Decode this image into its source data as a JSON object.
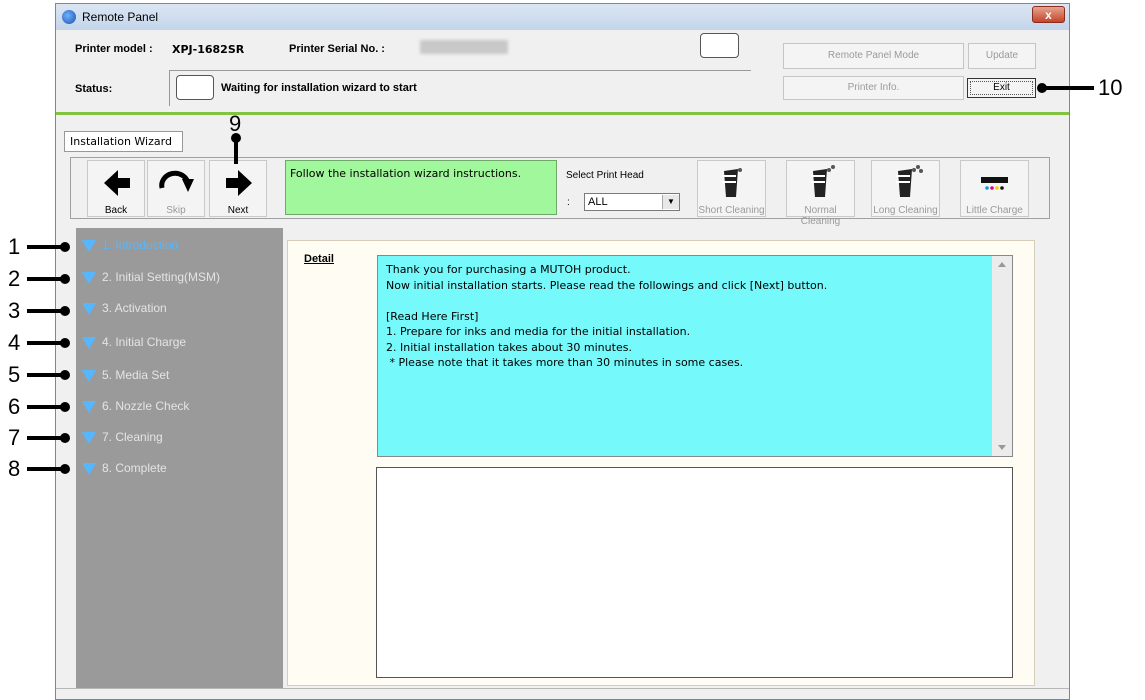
{
  "window": {
    "title": "Remote Panel",
    "close_label": "x"
  },
  "header": {
    "printer_model_label": "Printer model :",
    "printer_model_value": "XPJ-1682SR",
    "serial_label": "Printer Serial No. :",
    "serial_value": "",
    "status_label": "Status:",
    "status_text": "Waiting for installation wizard to start",
    "buttons": {
      "remote_panel_mode": "Remote Panel Mode",
      "update": "Update",
      "printer_info": "Printer Info.",
      "exit": "Exit"
    }
  },
  "tab": {
    "label": "Installation Wizard"
  },
  "toolbar": {
    "back": "Back",
    "skip": "Skip",
    "next": "Next",
    "instruction": "Follow the installation wizard instructions.",
    "select_print_head_label": "Select Print Head",
    "select_colon": ":",
    "print_head_value": "ALL",
    "short_cleaning": "Short Cleaning",
    "normal_cleaning": "Normal Cleaning",
    "long_cleaning": "Long Cleaning",
    "little_charge": "Little Charge"
  },
  "steps": [
    {
      "label": "1. Introduction",
      "active": true
    },
    {
      "label": "2. Initial Setting(MSM)",
      "active": false
    },
    {
      "label": "3. Activation",
      "active": false
    },
    {
      "label": "4. Initial Charge",
      "active": false
    },
    {
      "label": "5. Media Set",
      "active": false
    },
    {
      "label": "6. Nozzle Check",
      "active": false
    },
    {
      "label": "7. Cleaning",
      "active": false
    },
    {
      "label": "8. Complete",
      "active": false
    }
  ],
  "detail": {
    "label": "Detail",
    "text": "Thank you for purchasing a MUTOH product.\nNow initial installation starts. Please read the followings and click [Next] button.\n\n[Read Here First]\n1. Prepare for inks and media for the initial installation.\n2. Initial installation takes about 30 minutes.\n * Please note that it takes more than 30 minutes in some cases."
  },
  "callouts": [
    "1",
    "2",
    "3",
    "4",
    "5",
    "6",
    "7",
    "8",
    "9",
    "10"
  ],
  "colors": {
    "accent_green": "#82c341",
    "instruction_bg": "#a1f79b",
    "detail_bg": "#76f9fb",
    "steps_panel": "#9a9a9a",
    "step_active": "#56b7ff"
  }
}
